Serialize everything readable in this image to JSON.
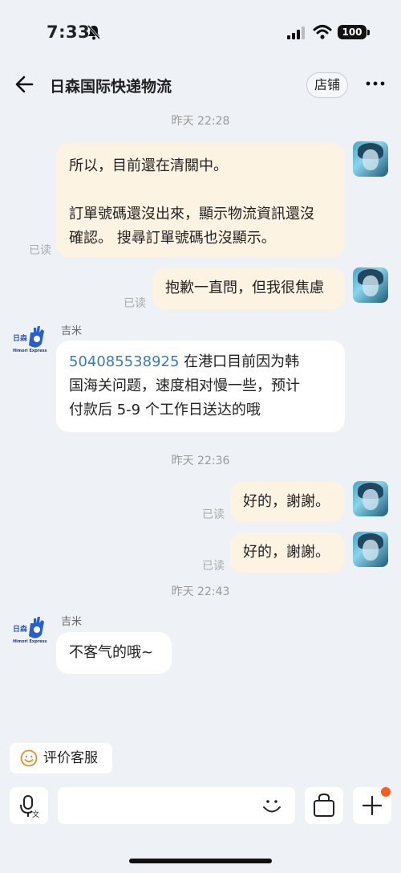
{
  "status": {
    "time": "7:33",
    "battery": "100"
  },
  "header": {
    "title": "日森国际快递物流",
    "store_label": "店铺"
  },
  "messages": {
    "ts1": "昨天 22:28",
    "m1_line1": "所以，目前還在清關中。",
    "m1_line2": "訂單號碼還沒出來，顯示物流資訊還沒",
    "m1_line3": "確認。 搜尋訂單號碼也沒顯示。",
    "m1_read": "已读",
    "m2_text": "抱歉一直問，但我很焦慮",
    "m2_read": "已读",
    "m3_sender": "吉米",
    "m3_order": "504085538925",
    "m3_text_a": " 在港口目前因为韩",
    "m3_line2": "国海关问题，速度相对慢一些，预计",
    "m3_line3": "付款后 5-9 个工作日送达的哦",
    "ts2": "昨天 22:36",
    "m4_text": "好的，謝謝。",
    "m4_read": "已读",
    "m5_text": "好的，謝謝。",
    "m5_read": "已读",
    "ts3": "昨天 22:43",
    "m6_sender": "吉米",
    "m6_text": "不客气的哦~"
  },
  "bot_logo": {
    "top": "日森",
    "bottom": "Himori Express"
  },
  "footer": {
    "rate_label": "评价客服",
    "input_placeholder": ""
  },
  "colors": {
    "accent": "#ff5a1f",
    "link": "#3d78c1",
    "mine_bubble": "#fdf3e2",
    "logo_blue": "#2a5fc7"
  },
  "icons": [
    "back-arrow-icon",
    "more-icon",
    "bell-mute-icon",
    "signal-icon",
    "wifi-icon",
    "smile-icon",
    "voice-icon",
    "emoji-icon",
    "bag-icon",
    "plus-icon"
  ]
}
